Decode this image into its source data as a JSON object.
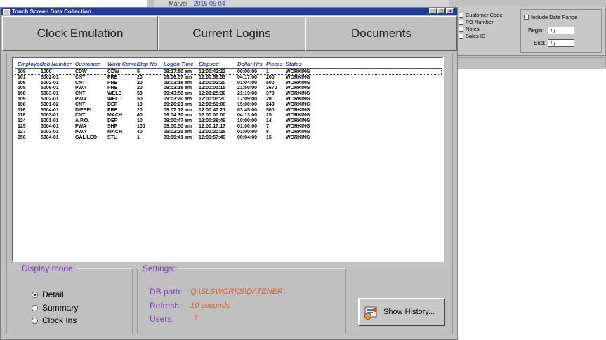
{
  "background_window": {
    "top_label": "Marvel",
    "top_value": "2015 05 04",
    "options": [
      "Customer Code",
      "PO Number",
      "Notes",
      "Sales ID"
    ],
    "date_range_label": "Include Date Range",
    "begin_label": "Begin:",
    "begin_value": "/ /",
    "end_label": "End:",
    "end_value": "/ /"
  },
  "window": {
    "title": "Touch Screen Data Collection",
    "controls": [
      "_",
      "□",
      "×"
    ]
  },
  "tabs": [
    "Clock Emulation",
    "Current Logins",
    "Documents"
  ],
  "logins_table": {
    "columns": [
      "Employee",
      "Job Number",
      "Customer",
      "Work Center",
      "Step No",
      "Logon Time",
      "Elapsed",
      "Dollar Hrs",
      "Pieces",
      "Status"
    ],
    "rows": [
      [
        "108",
        "1000",
        "CDW",
        "CDW",
        "5",
        "09:17:50 am",
        "12:00:42:22",
        "00:00:00",
        "1",
        "WORKING"
      ],
      [
        "101",
        "5002-01",
        "CNT",
        "PRE",
        "20",
        "09:06:57 am",
        "12:00:58:53",
        "04:17:00",
        "200",
        "WORKING"
      ],
      [
        "106",
        "5002-01",
        "CNT",
        "PRE",
        "20",
        "09:03:18 am",
        "12:00:02:20",
        "01:04:00",
        "500",
        "WORKING"
      ],
      [
        "108",
        "5006-01",
        "PWA",
        "PRE",
        "20",
        "09:03:18 am",
        "12:00:01:15",
        "21:50:00",
        "3670",
        "WORKING"
      ],
      [
        "108",
        "5003-01",
        "CNT",
        "WELD",
        "50",
        "09:43:50 am",
        "12:00:25:30",
        "21:19:00",
        "370",
        "WORKING"
      ],
      [
        "109",
        "5002-01",
        "PWA",
        "WELD",
        "50",
        "09:03:20 am",
        "12:00:05:20",
        "17:09:00",
        "20",
        "WORKING"
      ],
      [
        "108",
        "5001-02",
        "CNT",
        "DEP",
        "10",
        "09:26:21 am",
        "12:00:59:00",
        "15:00:00",
        "243",
        "WORKING"
      ],
      [
        "116",
        "5004-01",
        "DIESEL",
        "PRE",
        "20",
        "09:07:12 am",
        "12:00:47:21",
        "03:45:00",
        "500",
        "WORKING"
      ],
      [
        "118",
        "5003-01",
        "CNT",
        "MACH",
        "40",
        "09:04:30 am",
        "12:00:00:00",
        "04:13:00",
        "25",
        "WORKING"
      ],
      [
        "124",
        "5001-01",
        "A.P.O.",
        "DEP",
        "10",
        "09:00:47 am",
        "12:00:38:49",
        "10:00:00",
        "14",
        "WORKING"
      ],
      [
        "125",
        "5004-01",
        "PWA",
        "SHP",
        "100",
        "09:00:50 am",
        "12:00:17:17",
        "01:00:00",
        "7",
        "WORKING"
      ],
      [
        "127",
        "5003-01",
        "PWA",
        "MACH",
        "40",
        "09:02:25 am",
        "12:00:20:25",
        "01:00:00",
        "8",
        "WORKING"
      ],
      [
        "956",
        "5004-01",
        "GALILEO",
        "STL",
        "1",
        "09:00:41 am",
        "12:00:57:49",
        "00:04:00",
        "15",
        "WORKING"
      ]
    ]
  },
  "display_mode": {
    "title": "Display mode:",
    "options": [
      "Detail",
      "Summary",
      "Clock Ins"
    ],
    "selected": "Detail"
  },
  "settings": {
    "title": "Settings:",
    "db_path_label": "DB path:",
    "db_path_value": "Q:\\SLSWORKS\\DATENER\\",
    "refresh_label": "Refresh:",
    "refresh_value": "10 seconds",
    "users_label": "Users:",
    "users_value": "7"
  },
  "show_history_button": "Show History..."
}
